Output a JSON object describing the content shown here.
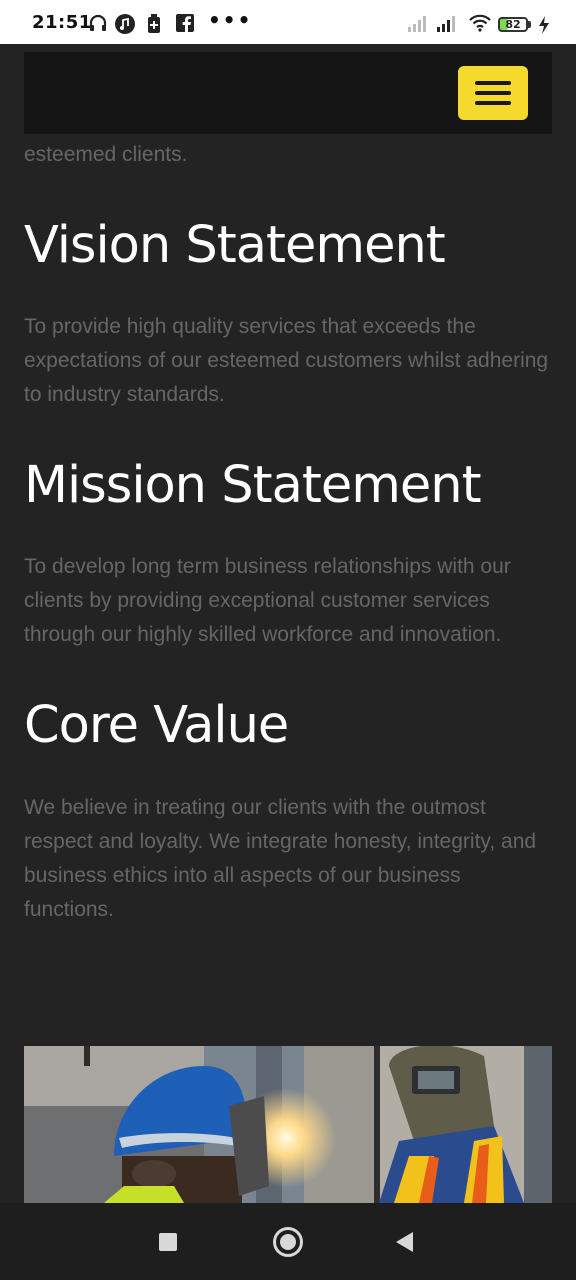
{
  "status_bar": {
    "time": "21:51",
    "more": "•••",
    "battery": "82",
    "icons": [
      "headphones-icon",
      "music-icon",
      "notification-icon",
      "facebook-icon",
      "signal-icon",
      "signal-icon",
      "wifi-icon",
      "battery-icon",
      "charging-icon"
    ]
  },
  "header": {
    "menu_icon": "hamburger-menu-icon",
    "menu_color": "#f5d92c"
  },
  "content": {
    "intro_tail": "esteemed clients.",
    "sections": [
      {
        "heading": "Vision Statement",
        "text": "To provide high quality services that exceeds the expectations of our esteemed customers whilst adhering to industry standards."
      },
      {
        "heading": "Mission Statement",
        "text": "To develop long term business relationships with our clients by providing exceptional customer services through our highly skilled workforce and innovation."
      },
      {
        "heading": "Core Value",
        "text": "We believe in treating our clients with the outmost respect and loyalty.  We integrate honesty, integrity, and business ethics into all aspects of our business functions."
      }
    ]
  },
  "photo": {
    "subject": "welders-photo"
  },
  "nav_bar": {
    "icons": [
      "recent-apps-icon",
      "home-icon",
      "back-icon"
    ]
  },
  "colors": {
    "background": "#232323",
    "heading": "#ffffff",
    "body_text": "#666666",
    "accent": "#f5d92c"
  }
}
